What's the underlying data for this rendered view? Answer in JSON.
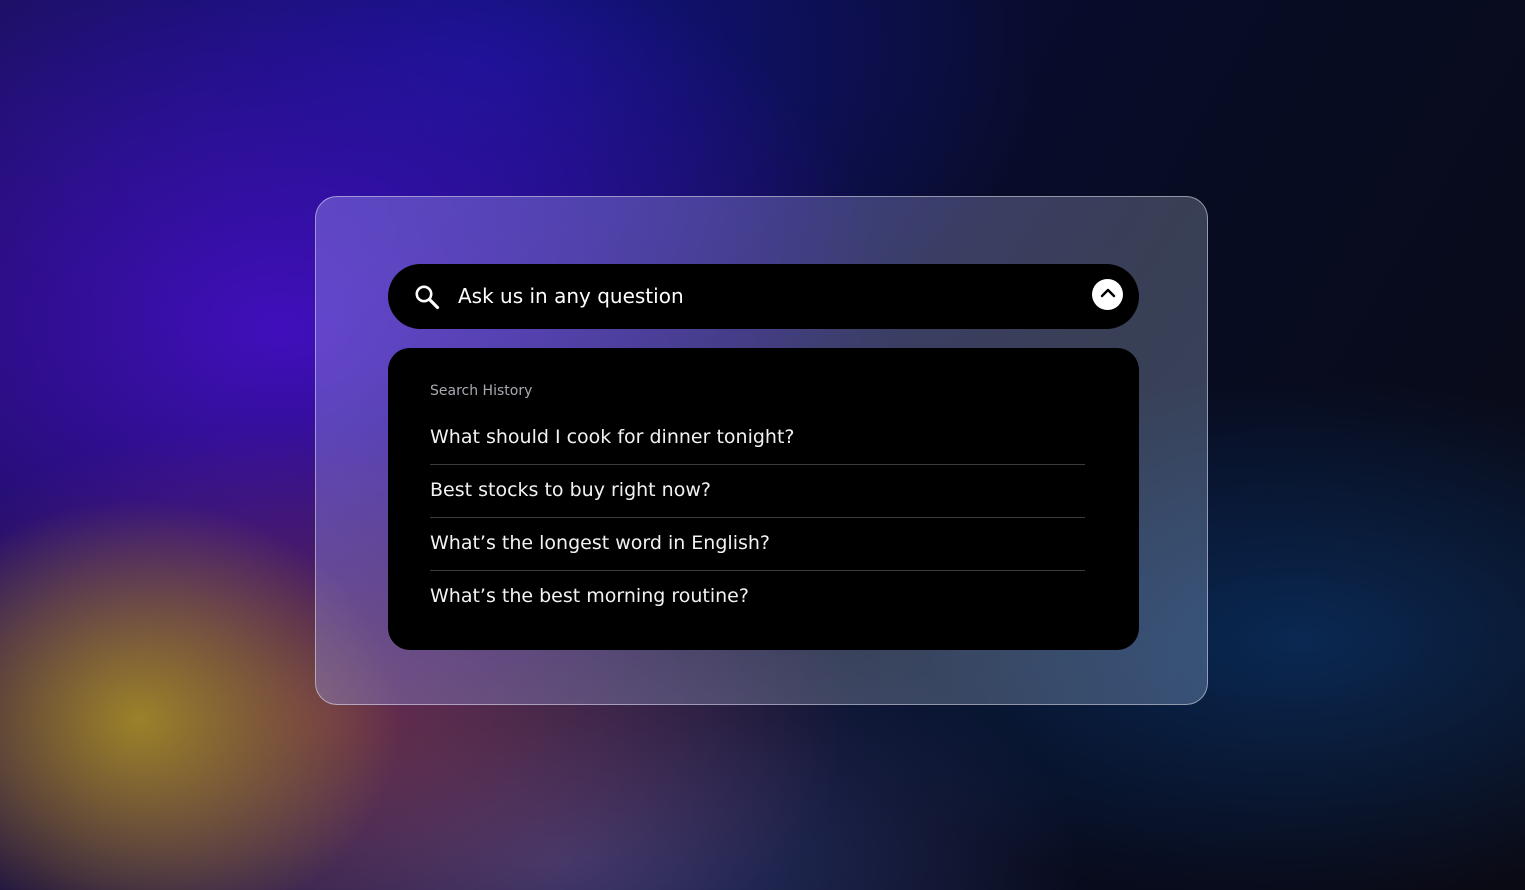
{
  "search": {
    "placeholder": "Ask us in any question",
    "icon": "search-icon",
    "collapse_icon": "chevron-up-icon"
  },
  "history": {
    "title": "Search History",
    "items": [
      {
        "label": "What should I cook for dinner tonight?"
      },
      {
        "label": "Best stocks to buy right now?"
      },
      {
        "label": "What’s the longest word in English?"
      },
      {
        "label": "What’s the best morning routine?"
      }
    ]
  },
  "colors": {
    "panel": "#000000",
    "text": "#ffffff",
    "muted_text": "#a9a9b2",
    "divider": "#3a3a3f"
  }
}
